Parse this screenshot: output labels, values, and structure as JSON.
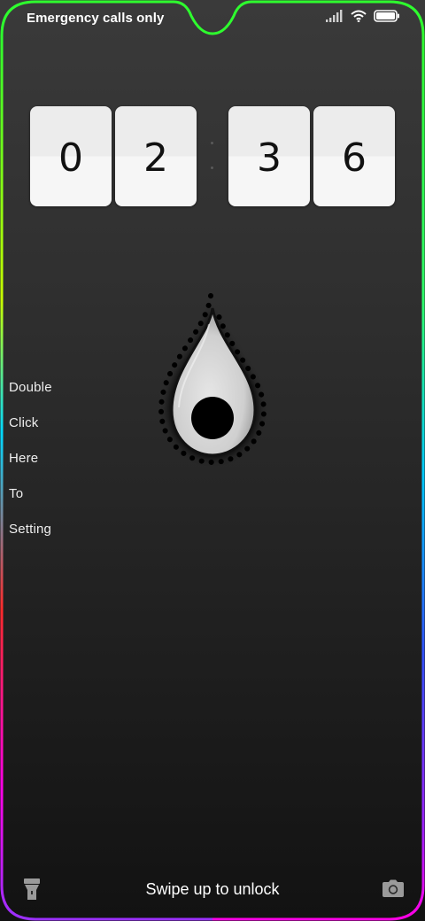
{
  "status_bar": {
    "carrier_text": "Emergency calls only",
    "signal_icon": "signal-bars-icon",
    "wifi_icon": "wifi-icon",
    "battery_icon": "battery-icon",
    "battery_level": 1.0
  },
  "clock": {
    "digits": [
      "0",
      "2",
      "3",
      "6"
    ],
    "hours": "02",
    "minutes": "36"
  },
  "side_text": {
    "words": [
      "Double",
      "Click",
      "Here",
      "To",
      "Setting"
    ]
  },
  "widget": {
    "icon": "water-drop-icon"
  },
  "bottom_bar": {
    "unlock_text": "Swipe up to unlock",
    "left_icon": "flashlight-icon",
    "right_icon": "camera-icon"
  },
  "colors": {
    "edge_gradient": [
      "#2eff2e",
      "#00e0ff",
      "#ff2a2a",
      "#ff00e6"
    ],
    "card_bg": "#f6f6f6",
    "digit_color": "#111111"
  }
}
